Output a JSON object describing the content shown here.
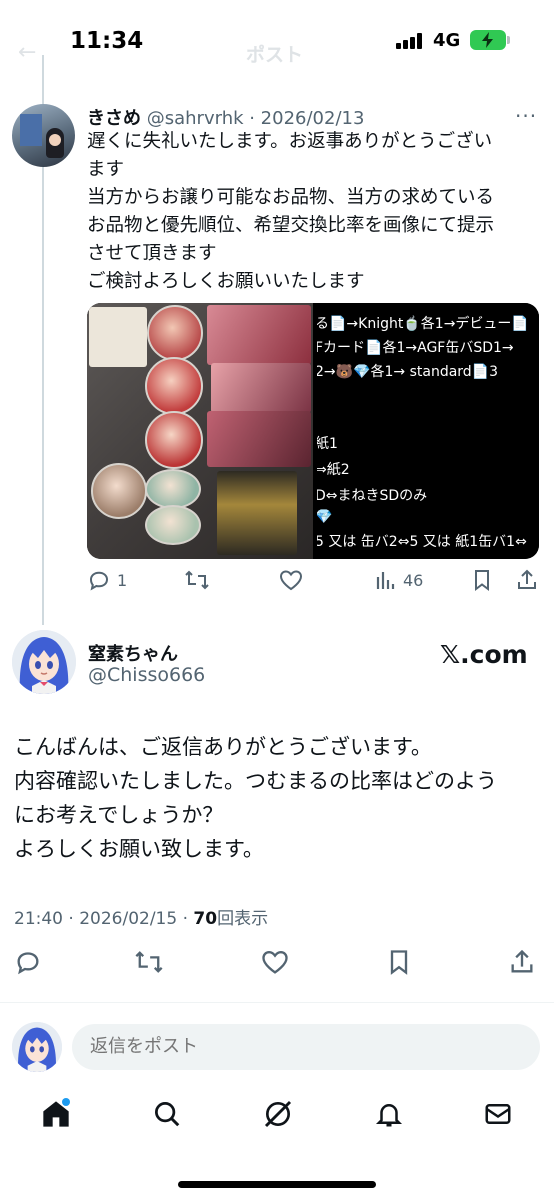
{
  "status_bar": {
    "time": "11:34",
    "network": "4G",
    "header_title_ghost": "ポスト"
  },
  "tweet1": {
    "author_name": "きさめ",
    "author_meta": "@sahrvrhk · 2026/02/13",
    "body_lines": [
      "遅くに失礼いたします。お返事ありがとうござい",
      "ます",
      "当方からお譲り可能なお品物、当方の求めている",
      "お品物と優先順位、希望交換比率を画像にて提示",
      "させて頂きます",
      "ご検討よろしくお願いいたします"
    ],
    "image_text_lines": [
      "る📄→Knight🍵各1→デビュー📄",
      "Fカード📄各1→AGF缶バSD1→",
      "2→🐻💎各1→ standard📄3",
      "",
      "紙1",
      "⇒紙2",
      "D⇔まねきSDのみ",
      "💎",
      "5 又は 缶バ2⇔5 又は 紙1缶バ1⇔"
    ],
    "replies": "1",
    "views": "46"
  },
  "tweet2": {
    "author_name": "窒素ちゃん",
    "author_handle": "@Chisso666",
    "watermark": "𝕏.com",
    "body_lines": [
      "こんばんは、ご返信ありがとうございます。",
      "内容確認いたしました。つむまるの比率はどのよう",
      "にお考えでしょうか？",
      "よろしくお願い致します。"
    ],
    "meta_prefix": "21:40 · 2026/02/15 · ",
    "views_count": "70",
    "views_label": "回表示"
  },
  "reply_bar": {
    "placeholder": "返信をポスト"
  },
  "colors": {
    "accent": "#1d9bf0",
    "secondary_text": "#536471",
    "battery": "#30c953"
  }
}
